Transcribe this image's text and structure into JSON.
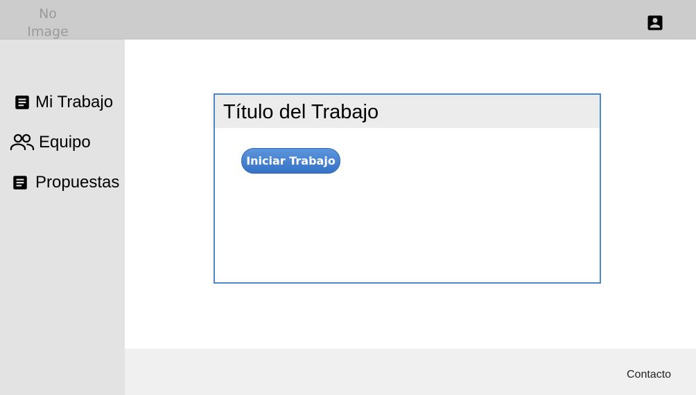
{
  "header": {
    "logo_text": "No Image",
    "profile_icon": "account-box-icon"
  },
  "sidebar": {
    "items": [
      {
        "label": "Mi Trabajo",
        "icon": "document-icon"
      },
      {
        "label": "Equipo",
        "icon": "group-icon"
      },
      {
        "label": "Propuestas",
        "icon": "document-icon"
      }
    ]
  },
  "main": {
    "card": {
      "title": "Título del Trabajo",
      "button_label": "Iniciar Trabajo"
    }
  },
  "footer": {
    "contact_label": "Contacto"
  },
  "colors": {
    "topbar": "#cccccc",
    "sidebar": "#e3e3e3",
    "accent": "#4a86c8",
    "button": "#3572c6",
    "footer": "#f0f0f0"
  }
}
